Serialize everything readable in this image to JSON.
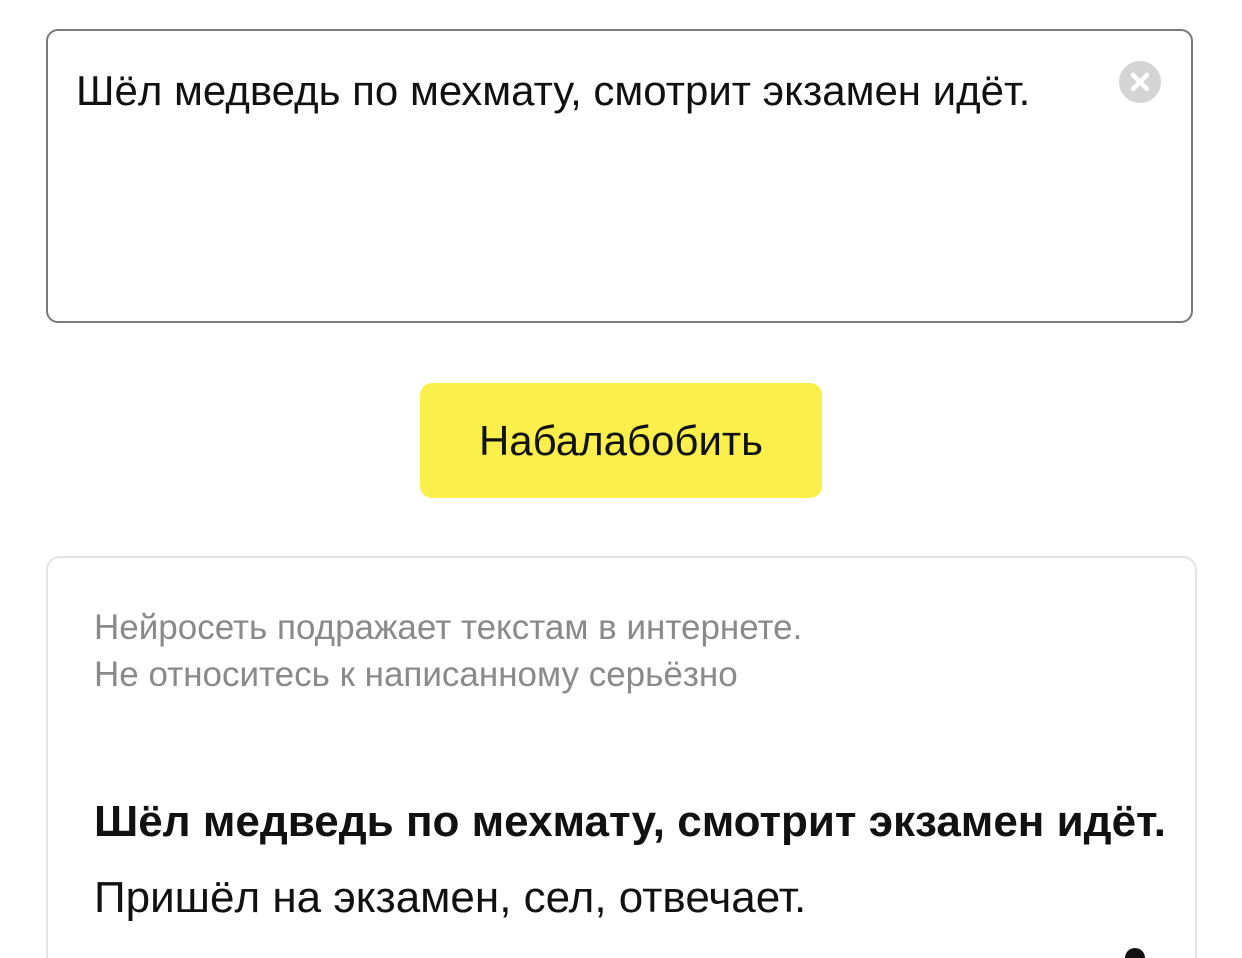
{
  "input": {
    "value": "Шёл медведь по мехмату, смотрит экзамен идёт."
  },
  "clear_icon": "close-circle-icon",
  "generate_button": {
    "label": "Набалабобить",
    "color": "#fbef4c"
  },
  "result": {
    "disclaimer_line1": "Нейросеть подражает текстам в интернете.",
    "disclaimer_line2": "Не относитесь к написанному серьёзно",
    "prompt_text": "Шёл медведь по мехмату, смотрит экзамен идёт.",
    "continuation_text": " Пришёл на экзамен, сел, отвечает."
  }
}
